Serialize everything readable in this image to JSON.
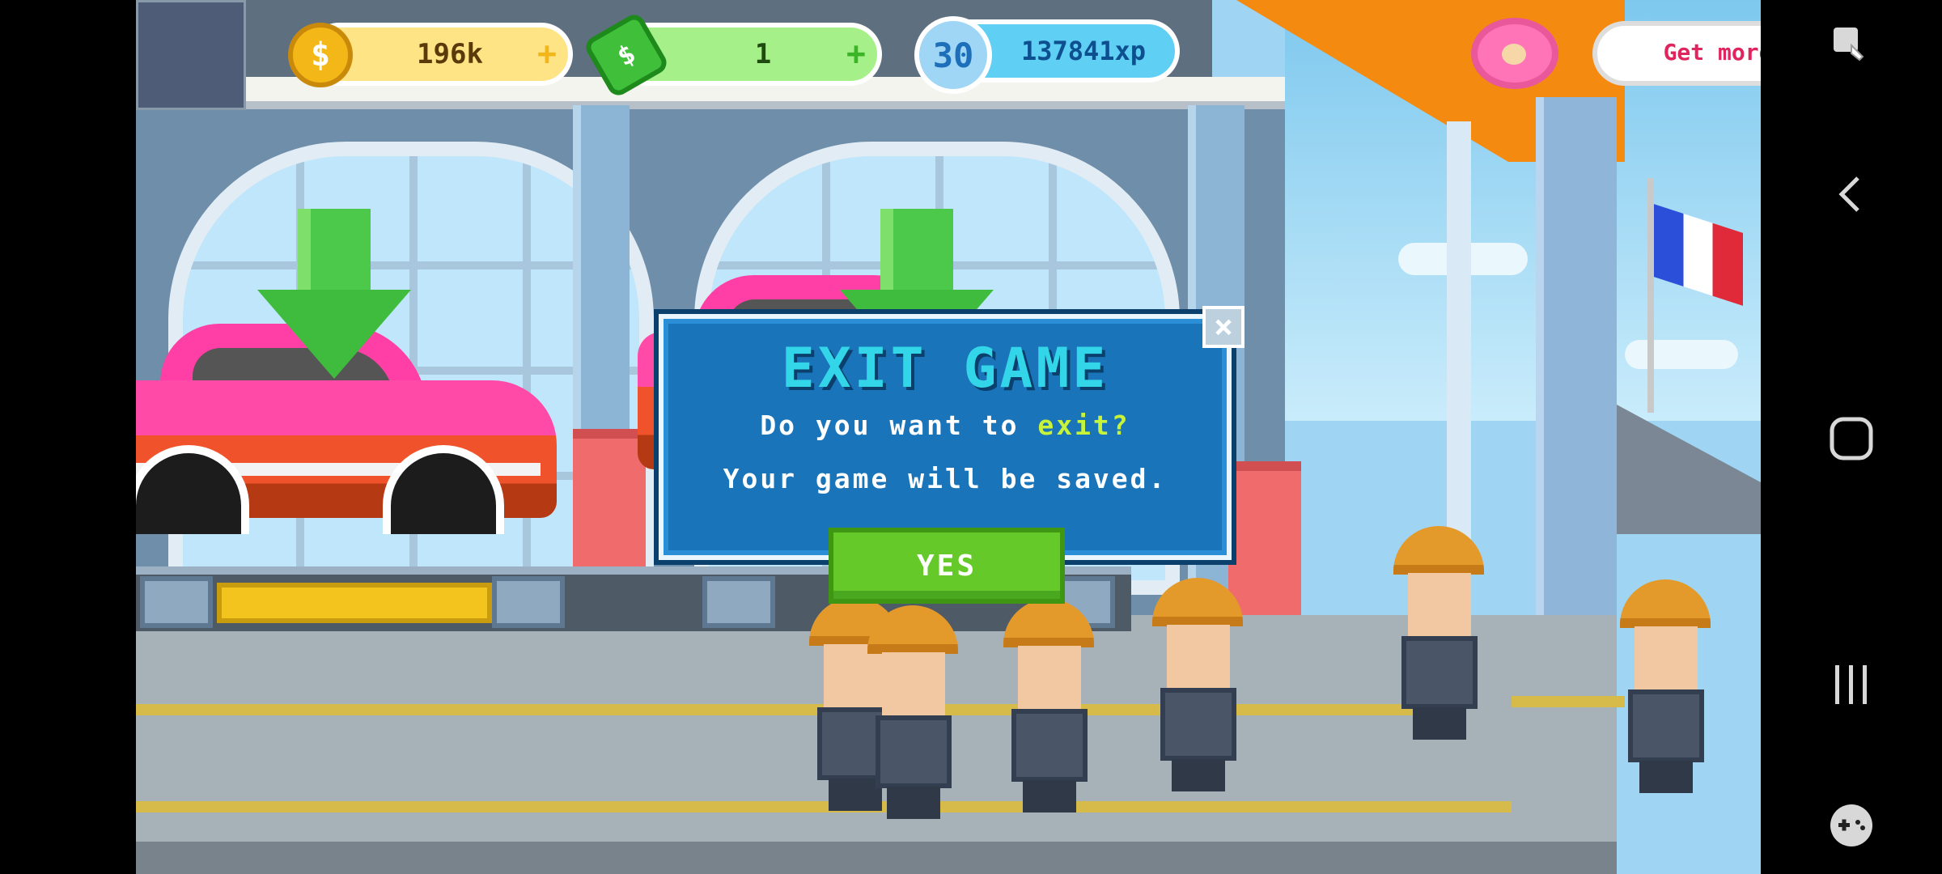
{
  "hud": {
    "coins": "196k",
    "cash": "1",
    "level": "30",
    "xp": "137841xp",
    "plus_symbol": "+",
    "coin_symbol": "$",
    "get_more_label": "Get more"
  },
  "dialog": {
    "title": "EXIT GAME",
    "question_prefix": "Do you want to ",
    "question_highlight": "exit?",
    "subtext": "Your game will be saved.",
    "yes_label": "YES",
    "close_symbol": "×"
  },
  "colors": {
    "dialog_bg": "#1a74b9",
    "title": "#33d6e8",
    "highlight": "#c7f33a",
    "yes_button": "#66c92a",
    "get_more_text": "#e0245e"
  },
  "icons": {
    "coin": "coin-icon",
    "cash": "cash-icon",
    "level": "level-badge-icon",
    "donut": "donut-icon",
    "close": "close-icon",
    "nav_screenshot": "screenshot-icon",
    "nav_back": "back-icon",
    "nav_home": "home-icon",
    "nav_recents": "recents-icon",
    "nav_game": "gamepad-icon"
  }
}
